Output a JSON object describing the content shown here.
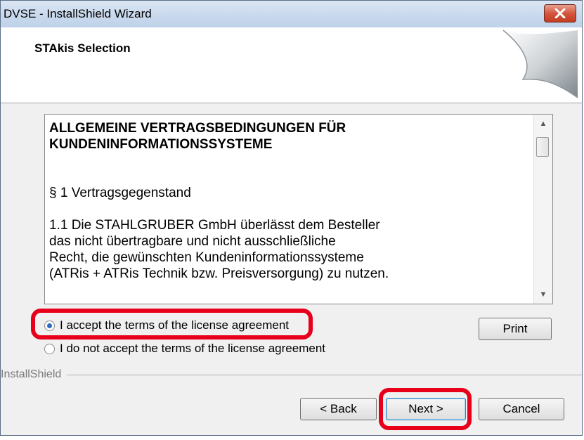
{
  "window": {
    "title": "DVSE - InstallShield Wizard"
  },
  "header": {
    "title": "STAkis Selection"
  },
  "license": {
    "heading": "ALLGEMEINE VERTRAGSBEDINGUNGEN FÜR KUNDENINFORMATIONSSYSTEME",
    "section": "§ 1 Vertragsgegenstand",
    "paragraph_lines": [
      "1.1 Die STAHLGRUBER GmbH überlässt dem Besteller",
      "das nicht übertragbare und nicht ausschließliche",
      "Recht, die gewünschten Kundeninformationssysteme",
      "(ATRis + ATRis Technik bzw. Preisversorgung) zu nutzen."
    ]
  },
  "options": {
    "accept": "I accept the terms of the license agreement",
    "decline": "I do not accept the terms of the license agreement",
    "selected": "accept"
  },
  "buttons": {
    "print": "Print",
    "back": "< Back",
    "next": "Next >",
    "cancel": "Cancel"
  },
  "branding": "InstallShield",
  "colors": {
    "highlight": "#e8001b",
    "selected_radio": "#2c6bbf"
  }
}
